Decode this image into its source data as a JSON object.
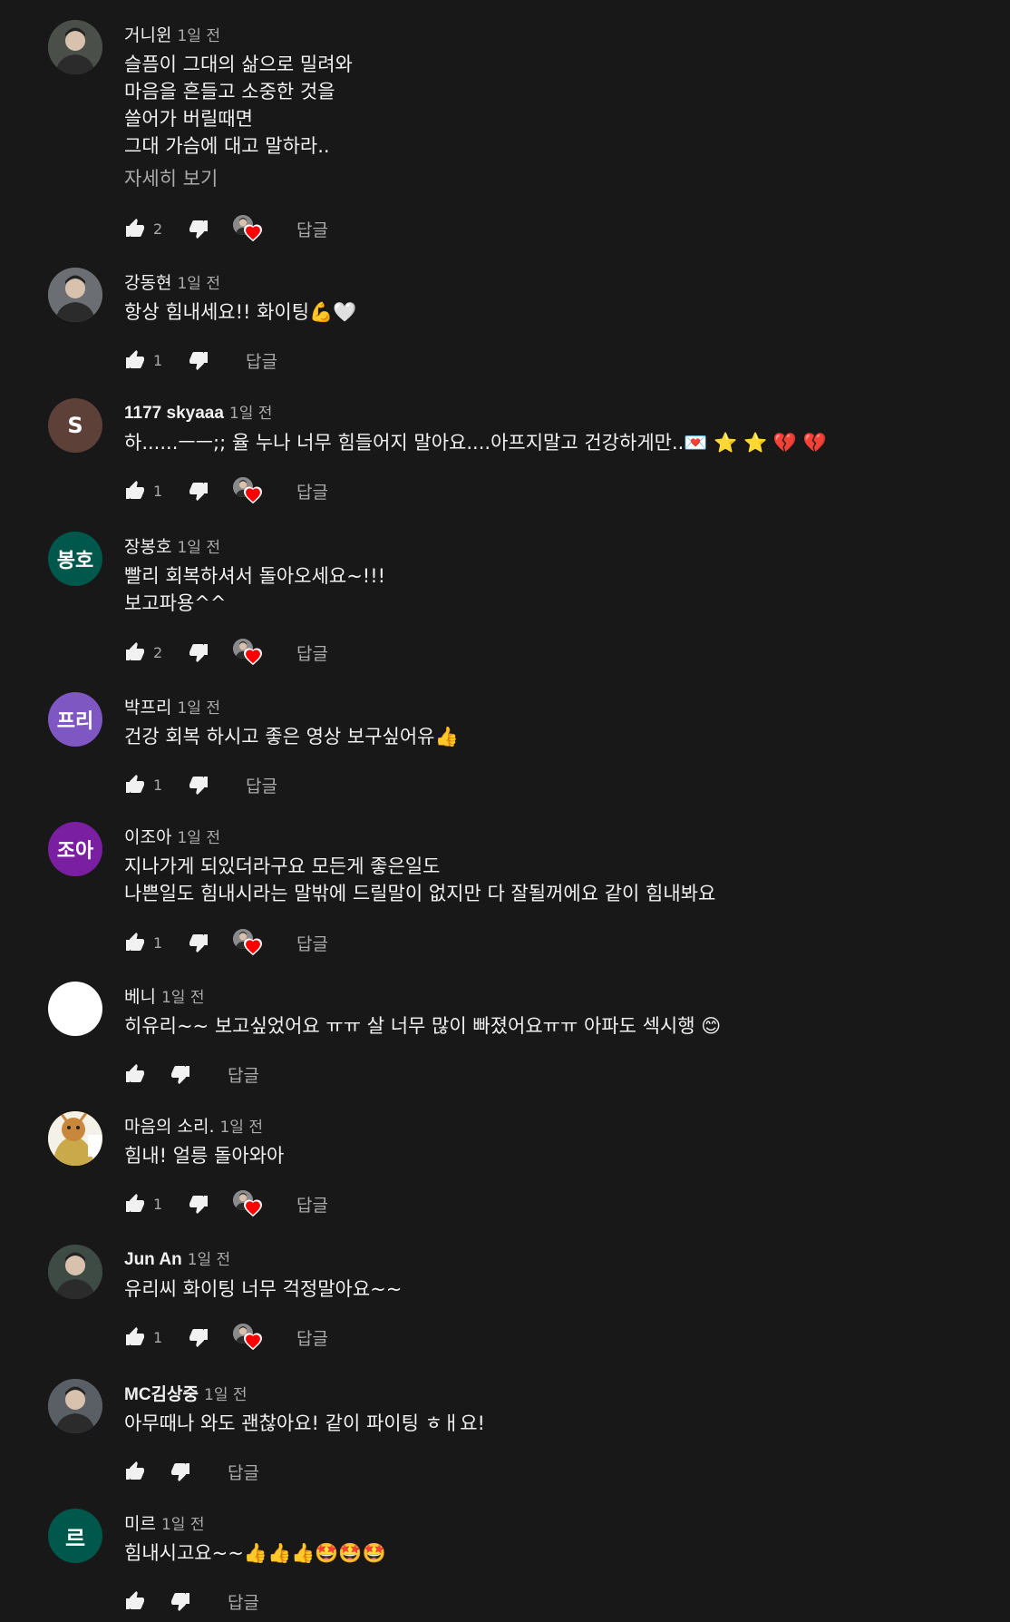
{
  "comments": [
    {
      "author": "거니윈",
      "time": "1일 전",
      "avatar": {
        "type": "photo",
        "bg": "#4a4f4a"
      },
      "lines": [
        "슬픔이 그대의 삶으로 밀려와",
        "마음을 흔들고 소중한 것을",
        "쓸어가 버릴때면",
        "그대 가슴에 대고 말하라.."
      ],
      "more": "자세히 보기",
      "likes": "2",
      "creator_heart": true,
      "reply": "답글"
    },
    {
      "author": "강동현",
      "time": "1일 전",
      "avatar": {
        "type": "photo",
        "bg": "#6b6e72"
      },
      "lines": [
        "항상 힘내세요!! 화이팅💪🤍"
      ],
      "likes": "1",
      "creator_heart": false,
      "reply": "답글"
    },
    {
      "author": "1177 skyaaa",
      "time": "1일 전",
      "avatar": {
        "type": "letter",
        "text": "S",
        "bg": "#5d4037"
      },
      "lines": [
        "하......ㅡㅡ;; 율 누나 너무 힘들어지 말아요....아프지말고 건강하게만..💌 ⭐ ⭐ 💔 💔"
      ],
      "likes": "1",
      "creator_heart": true,
      "reply": "답글"
    },
    {
      "author": "장봉호",
      "time": "1일 전",
      "avatar": {
        "type": "letter",
        "text": "봉호",
        "bg": "#00574b"
      },
      "lines": [
        "빨리 회복하셔서 돌아오세요~!!!",
        "보고파용^^"
      ],
      "likes": "2",
      "creator_heart": true,
      "reply": "답글"
    },
    {
      "author": "박프리",
      "time": "1일 전",
      "avatar": {
        "type": "letter",
        "text": "프리",
        "bg": "#7e57c2"
      },
      "lines": [
        "건강 회복 하시고 좋은 영상 보구싶어유👍"
      ],
      "likes": "1",
      "creator_heart": false,
      "reply": "답글"
    },
    {
      "author": "이조아",
      "time": "1일 전",
      "avatar": {
        "type": "letter",
        "text": "조아",
        "bg": "#7b1fa2"
      },
      "lines": [
        "지나가게 되있더라구요 모든게 좋은일도",
        "나쁜일도 힘내시라는 말밖에 드릴말이 없지만 다 잘될꺼에요 같이 힘내봐요"
      ],
      "likes": "1",
      "creator_heart": true,
      "reply": "답글"
    },
    {
      "author": "베니",
      "time": "1일 전",
      "avatar": {
        "type": "white",
        "bg": "#ffffff"
      },
      "lines": [
        "히유리~~ 보고싶었어요 ㅠㅠ 살 너무 많이 빠졌어요ㅠㅠ 아파도 섹시행 😊"
      ],
      "likes": "",
      "creator_heart": false,
      "reply": "답글"
    },
    {
      "author": "마음의 소리.",
      "time": "1일 전",
      "avatar": {
        "type": "cartoon",
        "bg": "#c9a94a"
      },
      "lines": [
        "힘내! 얼릉 돌아와아"
      ],
      "likes": "1",
      "creator_heart": true,
      "reply": "답글"
    },
    {
      "author": "Jun An",
      "time": "1일 전",
      "avatar": {
        "type": "photo",
        "bg": "#3e4a44"
      },
      "lines": [
        "유리씨 화이팅 너무 걱정말아요~~"
      ],
      "likes": "1",
      "creator_heart": true,
      "reply": "답글"
    },
    {
      "author": "MC김상중",
      "time": "1일 전",
      "avatar": {
        "type": "photo",
        "bg": "#5a5f66"
      },
      "lines": [
        "아무때나 와도 괜찮아요! 같이 파이팅 ㅎㅐ요!"
      ],
      "likes": "",
      "creator_heart": false,
      "reply": "답글"
    },
    {
      "author": "미르",
      "time": "1일 전",
      "avatar": {
        "type": "letter",
        "text": "르",
        "bg": "#00574b"
      },
      "lines": [
        "힘내시고요~~👍👍👍🤩🤩🤩"
      ],
      "likes": "",
      "creator_heart": false,
      "reply": "답글"
    }
  ],
  "colors": {
    "background": "#181818",
    "text": "#f1f1f1",
    "muted": "#aaaaaa",
    "heart": "#ff0000"
  }
}
